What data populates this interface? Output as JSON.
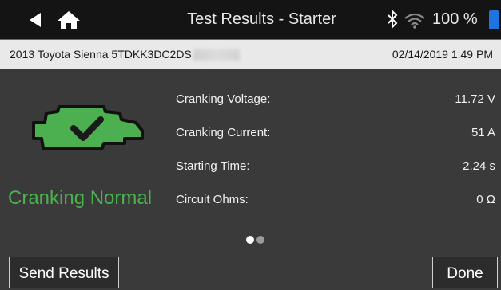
{
  "header": {
    "title": "Test Results - Starter",
    "battery_percent": "100 %",
    "icons": [
      "back-arrow-icon",
      "home-icon",
      "bluetooth-icon",
      "wifi-icon",
      "battery-icon"
    ]
  },
  "vehicle": {
    "description": "2013 Toyota Sienna",
    "vin_visible": "5TDKK3DC2DS",
    "datetime": "02/14/2019 1:49 PM"
  },
  "status": {
    "label": "Cranking Normal",
    "icon": "engine-check-icon",
    "color": "#4caf50"
  },
  "results": [
    {
      "label": "Cranking Voltage:",
      "value": "11.72 V"
    },
    {
      "label": "Cranking Current:",
      "value": "51 A"
    },
    {
      "label": "Starting Time:",
      "value": "2.24 s"
    },
    {
      "label": "Circuit Ohms:",
      "value": "0 Ω"
    }
  ],
  "pager": {
    "current": 1,
    "total": 2
  },
  "buttons": {
    "send": "Send Results",
    "done": "Done"
  }
}
